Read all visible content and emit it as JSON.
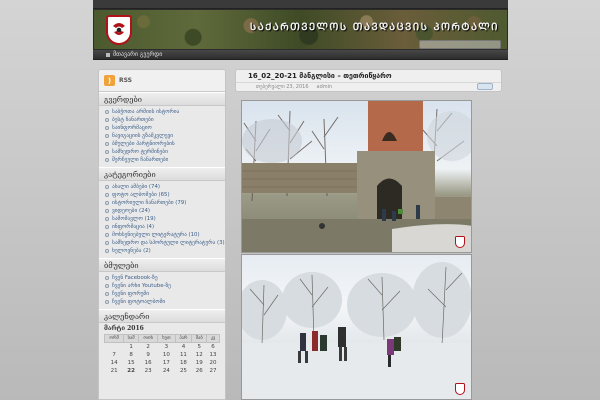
{
  "header": {
    "site_title": "ᲡᲐᲥᲐᲠᲗᲕᲔᲚᲝᲡ ᲗᲐᲕᲓᲐᲪᲕᲘᲡ ᲞᲝᲠᲢᲐᲚᲘ",
    "search_placeholder": "",
    "logo_icon": "shield-logo-icon"
  },
  "menu": {
    "home_label": "მთავარი გვერდი"
  },
  "sidebar": {
    "rss_label": "RSS",
    "pages_title": "გვერდები",
    "pages": [
      "საბჭოთა არმიის ისტორია",
      "ბესტ ჩანართები",
      "საინფორმაციო",
      "ნავიგაციის გზამკვლევი",
      "ბმულები პარტნიორების",
      "სამხედრო ტერმინები",
      "შერჩეული ჩანართები"
    ],
    "categories_title": "კატეგორიები",
    "categories": [
      "ახალი ამბები (74)",
      "ფოტო ალბომები (65)",
      "ისტორიული ჩანართები (79)",
      "ვიდეოები (24)",
      "სამომავლო (19)",
      "ინფორმაცია (4)",
      "მოხსენიებული ლიტერატურა (10)",
      "სამხედრო და სპორტული ლიტერატურა (3)",
      "ხელოვნება (2)"
    ],
    "links_title": "ბმულები",
    "links": [
      "ჩვენ Facebook-ზე",
      "ჩვენი არხი Youtube-ზე",
      "ჩვენი ფორუმი",
      "ჩვენი ფოტოალბომი"
    ],
    "calendar_title": "კალენდარი",
    "calendar": {
      "caption": "მარტი 2016",
      "weekdays": [
        "ორშ",
        "სამ",
        "ოთხ",
        "ხუთ",
        "პარ",
        "შაბ",
        "კვ"
      ],
      "rows": [
        [
          "",
          "1",
          "2",
          "3",
          "4",
          "5",
          "6"
        ],
        [
          "7",
          "8",
          "9",
          "10",
          "11",
          "12",
          "13"
        ],
        [
          "14",
          "15",
          "16",
          "17",
          "18",
          "19",
          "20"
        ],
        [
          "21",
          "22",
          "23",
          "24",
          "25",
          "26",
          "27"
        ]
      ],
      "today": "22"
    }
  },
  "post": {
    "title": "16_02_20-21 მანგლისი – თეთრიწყარო",
    "date": "თებერვალი 23, 2016",
    "author": "admin",
    "comment_icon": "comment-bubble-icon"
  },
  "colors": {
    "accent_red": "#b01218",
    "link_blue": "#3b5e8a"
  }
}
